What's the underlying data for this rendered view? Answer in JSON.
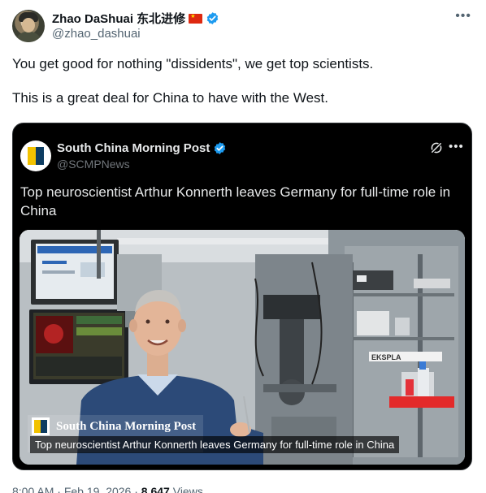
{
  "author": {
    "display_name": "Zhao DaShuai 东北进修",
    "handle": "@zhao_dashuai",
    "verified": true,
    "flag_icon": "china-flag-icon"
  },
  "post": {
    "paragraphs": [
      "You get good for nothing \"dissidents\", we get top scientists.",
      "This is a great deal for China to have with the West."
    ]
  },
  "quote": {
    "display_name": "South China Morning Post",
    "handle": "@SCMPNews",
    "verified": true,
    "text": "Top neuroscientist Arthur Konnerth leaves Germany for full-time role in China",
    "media": {
      "watermark": "South China Morning Post",
      "caption": "Top neuroscientist Arthur Konnerth leaves Germany for full-time role in China",
      "equipment_label": "EKSPLA"
    }
  },
  "meta": {
    "time": "8:00 AM",
    "separator": "·",
    "date": "Feb 19, 2026",
    "views_count": "8,647",
    "views_label": "Views"
  },
  "colors": {
    "verified_blue": "#1d9bf0",
    "text_primary": "#0f1419",
    "text_secondary": "#536471",
    "card_background": "#000000"
  }
}
